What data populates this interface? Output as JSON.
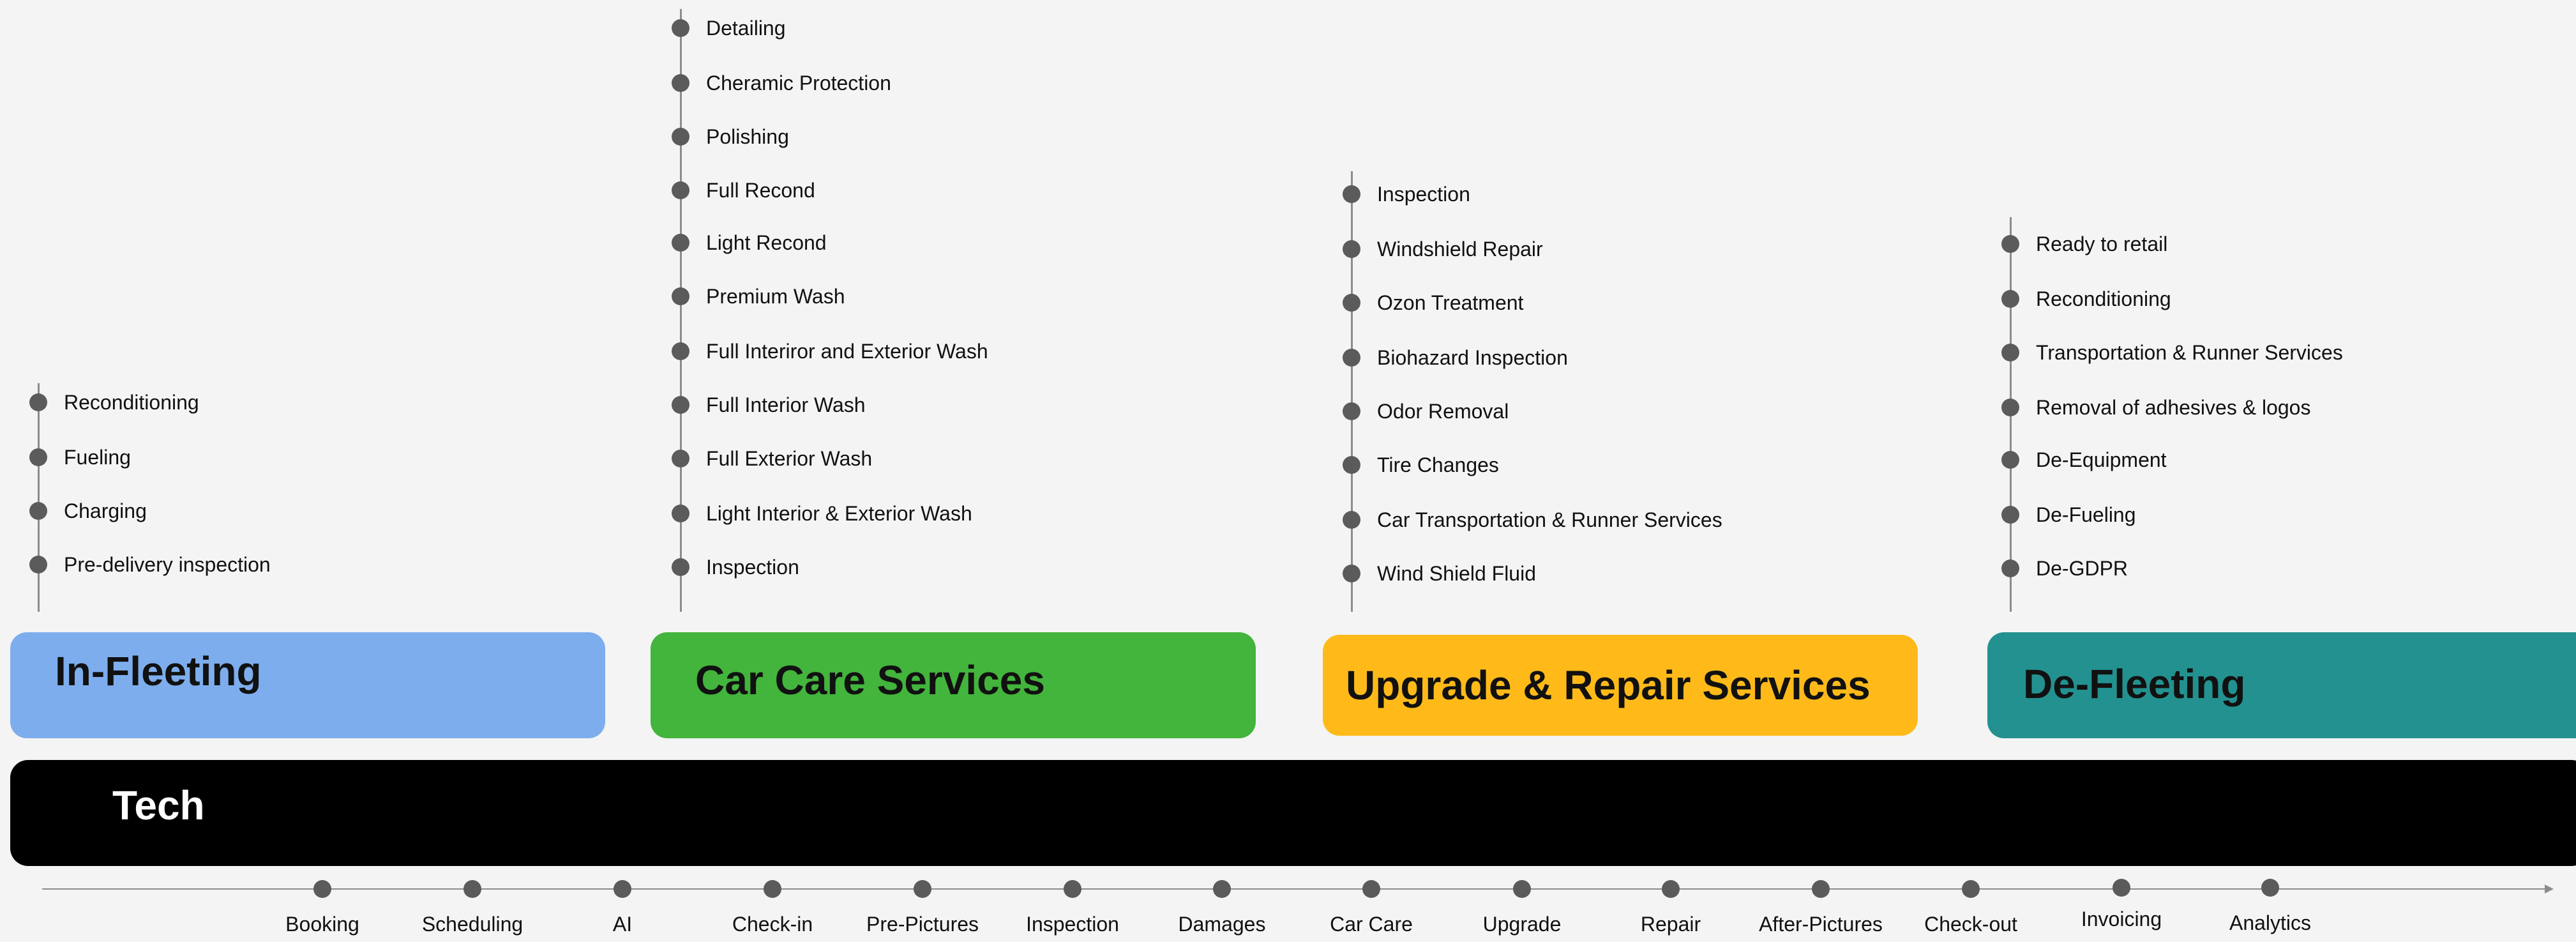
{
  "colors": {
    "in_fleeting": "#7daded",
    "car_care": "#43b43c",
    "upgrade_repair": "#ffba19",
    "de_fleeting": "#23918f",
    "tech": "#000000"
  },
  "categories": [
    {
      "key": "in_fleeting",
      "title": "In-Fleeting",
      "items": [
        "Reconditioning",
        "Fueling",
        "Charging",
        "Pre-delivery inspection"
      ]
    },
    {
      "key": "car_care",
      "title": "Car Care Services",
      "items": [
        "Detailing",
        "Cheramic Protection",
        "Polishing",
        "Full Recond",
        "Light Recond",
        "Premium Wash",
        "Full Interiror and Exterior Wash",
        "Full Interior Wash",
        "Full Exterior Wash",
        "Light Interior & Exterior Wash",
        "Inspection"
      ]
    },
    {
      "key": "upgrade_repair",
      "title": "Upgrade & Repair Services",
      "items": [
        "Inspection",
        "Windshield Repair",
        "Ozon Treatment",
        "Biohazard Inspection",
        "Odor Removal",
        "Tire Changes",
        "Car Transportation & Runner Services",
        "Wind Shield Fluid"
      ]
    },
    {
      "key": "de_fleeting",
      "title": "De-Fleeting",
      "items": [
        "Ready to retail",
        "Reconditioning",
        "Transportation & Runner Services",
        "Removal of adhesives & logos",
        "De-Equipment",
        "De-Fueling",
        "De-GDPR"
      ]
    }
  ],
  "tech": {
    "title": "Tech"
  },
  "timeline": {
    "steps": [
      "Booking",
      "Scheduling",
      "AI",
      "Check-in",
      "Pre-Pictures",
      "Inspection",
      "Damages",
      "Car Care",
      "Upgrade",
      "Repair",
      "After-Pictures",
      "Check-out",
      "Invoicing",
      "Analytics"
    ]
  }
}
